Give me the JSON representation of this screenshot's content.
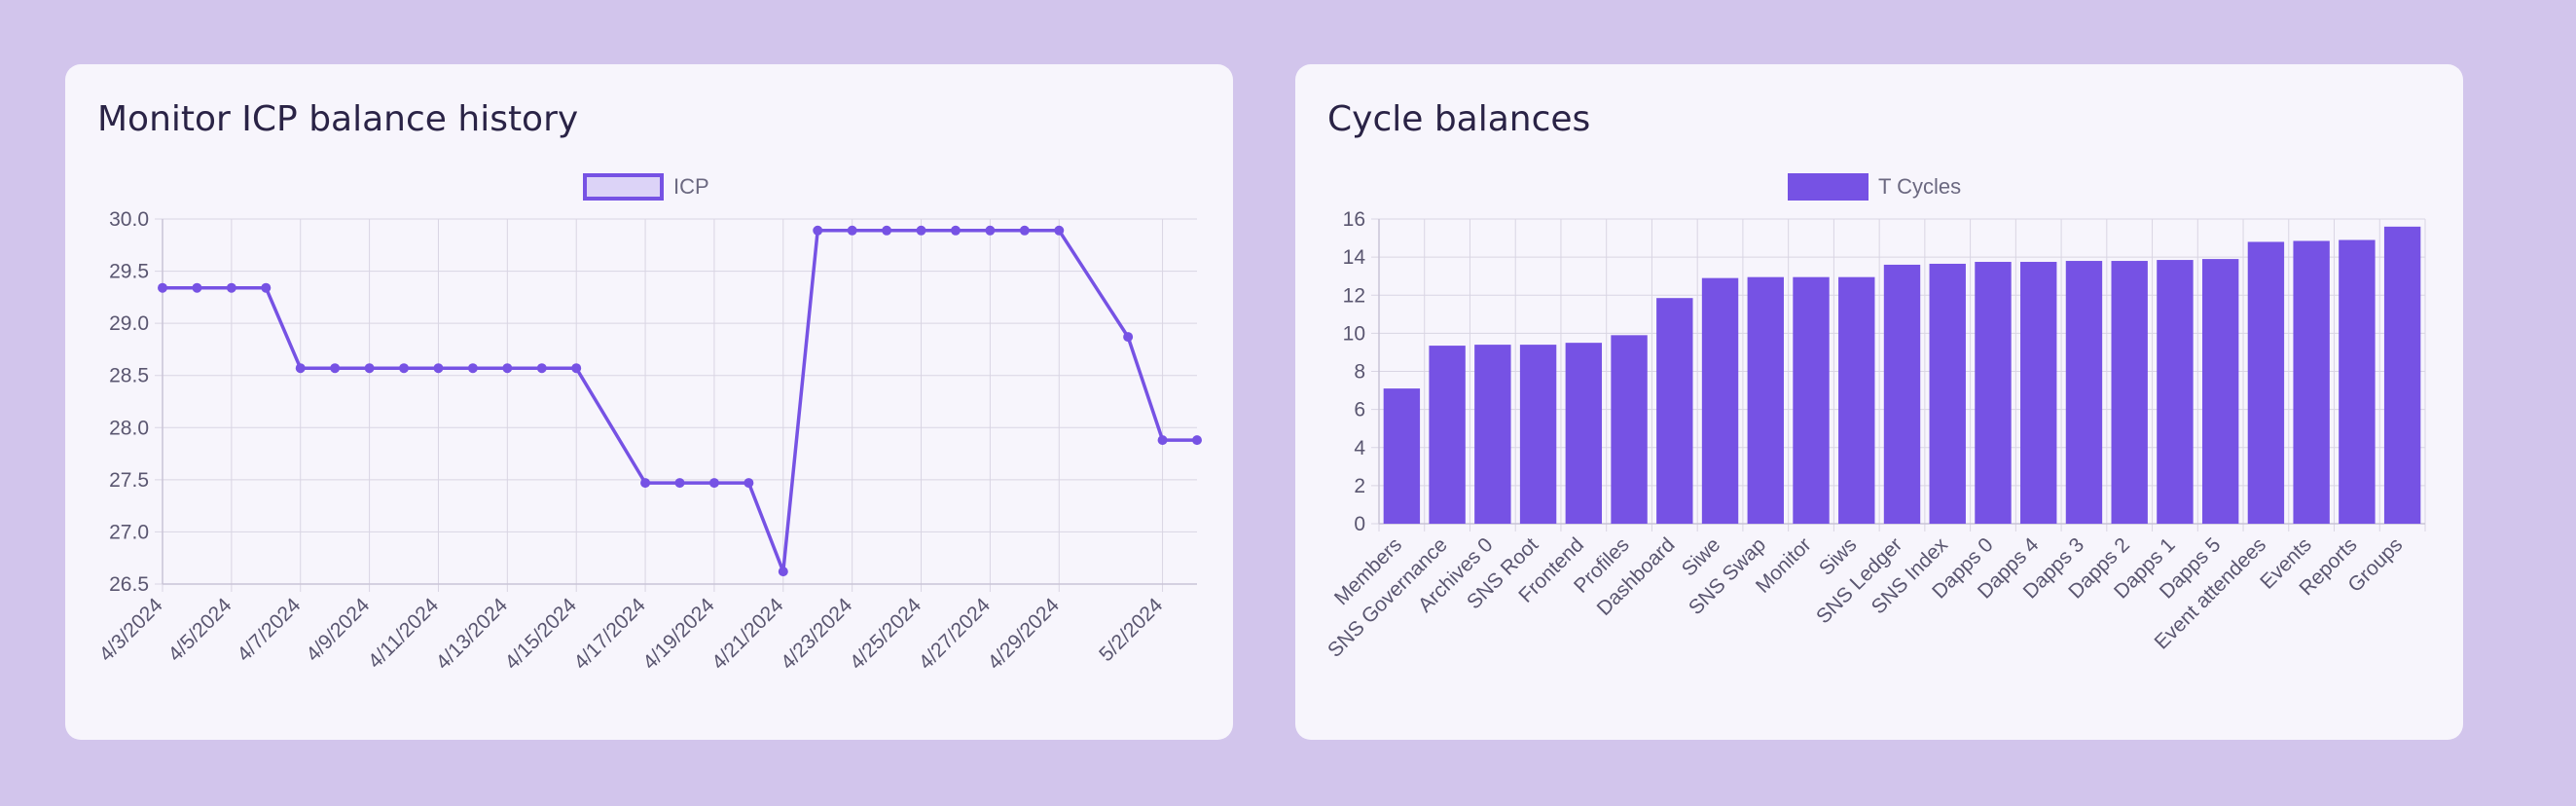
{
  "page": {
    "background": "#d2c5ec",
    "card_background": "#f7f5fc"
  },
  "chart_data": [
    {
      "id": "icp-balance-history",
      "type": "line",
      "title": "Monitor ICP balance history",
      "legend": {
        "label": "ICP",
        "position": "top"
      },
      "color": "#7652e4",
      "fill_color": "#dcd3f7",
      "grid": true,
      "ylim": [
        26.5,
        30.0
      ],
      "y_ticks": [
        "30.0",
        "29.5",
        "29.0",
        "28.5",
        "28.0",
        "27.5",
        "27.0",
        "26.5"
      ],
      "x_ticks": [
        "4/3/2024",
        "4/5/2024",
        "4/7/2024",
        "4/9/2024",
        "4/11/2024",
        "4/13/2024",
        "4/15/2024",
        "4/17/2024",
        "4/19/2024",
        "4/21/2024",
        "4/23/2024",
        "4/25/2024",
        "4/27/2024",
        "4/29/2024",
        "5/2/2024"
      ],
      "points": [
        {
          "x": "4/3/2024",
          "y": 29.34
        },
        {
          "x": "4/4/2024",
          "y": 29.34
        },
        {
          "x": "4/5/2024",
          "y": 29.34
        },
        {
          "x": "4/6/2024",
          "y": 29.34
        },
        {
          "x": "4/7/2024",
          "y": 28.57
        },
        {
          "x": "4/8/2024",
          "y": 28.57
        },
        {
          "x": "4/9/2024",
          "y": 28.57
        },
        {
          "x": "4/10/2024",
          "y": 28.57
        },
        {
          "x": "4/11/2024",
          "y": 28.57
        },
        {
          "x": "4/12/2024",
          "y": 28.57
        },
        {
          "x": "4/13/2024",
          "y": 28.57
        },
        {
          "x": "4/14/2024",
          "y": 28.57
        },
        {
          "x": "4/15/2024",
          "y": 28.57
        },
        {
          "x": "4/17/2024",
          "y": 27.47
        },
        {
          "x": "4/18/2024",
          "y": 27.47
        },
        {
          "x": "4/19/2024",
          "y": 27.47
        },
        {
          "x": "4/20/2024",
          "y": 27.47
        },
        {
          "x": "4/21/2024",
          "y": 26.62
        },
        {
          "x": "4/22/2024",
          "y": 29.89
        },
        {
          "x": "4/23/2024",
          "y": 29.89
        },
        {
          "x": "4/24/2024",
          "y": 29.89
        },
        {
          "x": "4/25/2024",
          "y": 29.89
        },
        {
          "x": "4/26/2024",
          "y": 29.89
        },
        {
          "x": "4/27/2024",
          "y": 29.89
        },
        {
          "x": "4/28/2024",
          "y": 29.89
        },
        {
          "x": "4/29/2024",
          "y": 29.89
        },
        {
          "x": "5/1/2024",
          "y": 28.87
        },
        {
          "x": "5/2/2024",
          "y": 27.88
        },
        {
          "x": "5/3/2024",
          "y": 27.88
        }
      ]
    },
    {
      "id": "cycle-balances",
      "type": "bar",
      "title": "Cycle balances",
      "legend": {
        "label": "T Cycles",
        "position": "top"
      },
      "color": "#7652e4",
      "grid": true,
      "ylim": [
        0,
        16
      ],
      "y_ticks": [
        "16",
        "14",
        "12",
        "10",
        "8",
        "6",
        "4",
        "2",
        "0"
      ],
      "categories": [
        "Members",
        "SNS Governance",
        "Archives 0",
        "SNS Root",
        "Frontend",
        "Profiles",
        "Dashboard",
        "Siwe",
        "SNS Swap",
        "Monitor",
        "Siws",
        "SNS Ledger",
        "SNS Index",
        "Dapps 0",
        "Dapps 4",
        "Dapps 3",
        "Dapps 2",
        "Dapps 1",
        "Dapps 5",
        "Event attendees",
        "Events",
        "Reports",
        "Groups"
      ],
      "values": [
        7.1,
        9.35,
        9.4,
        9.4,
        9.5,
        9.9,
        11.85,
        12.9,
        12.95,
        12.95,
        12.95,
        13.6,
        13.65,
        13.75,
        13.75,
        13.8,
        13.8,
        13.85,
        13.9,
        14.8,
        14.85,
        14.9,
        15.6
      ]
    }
  ]
}
